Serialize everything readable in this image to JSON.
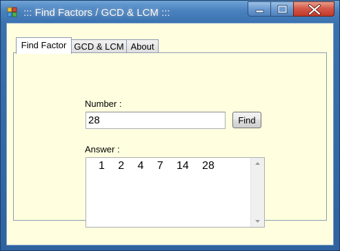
{
  "window": {
    "title": "::: Find Factors / GCD & LCM :::"
  },
  "tabs": [
    {
      "label": "Find Factor",
      "active": true
    },
    {
      "label": "GCD & LCM",
      "active": false
    },
    {
      "label": "About",
      "active": false
    }
  ],
  "form": {
    "number_label": "Number :",
    "number_value": "28",
    "find_button": "Find",
    "answer_label": "Answer :",
    "answer_value": "1   2   4   7   14   28"
  },
  "icons": {
    "app": "app-icon",
    "minimize": "minimize-icon",
    "maximize": "maximize-icon",
    "close": "close-icon",
    "scroll_up": "scroll-up-arrow-icon",
    "scroll_down": "scroll-down-arrow-icon"
  },
  "colors": {
    "client_background": "#ffffe0",
    "titlebar": "#4a82bf",
    "close_button": "#c0392b"
  }
}
